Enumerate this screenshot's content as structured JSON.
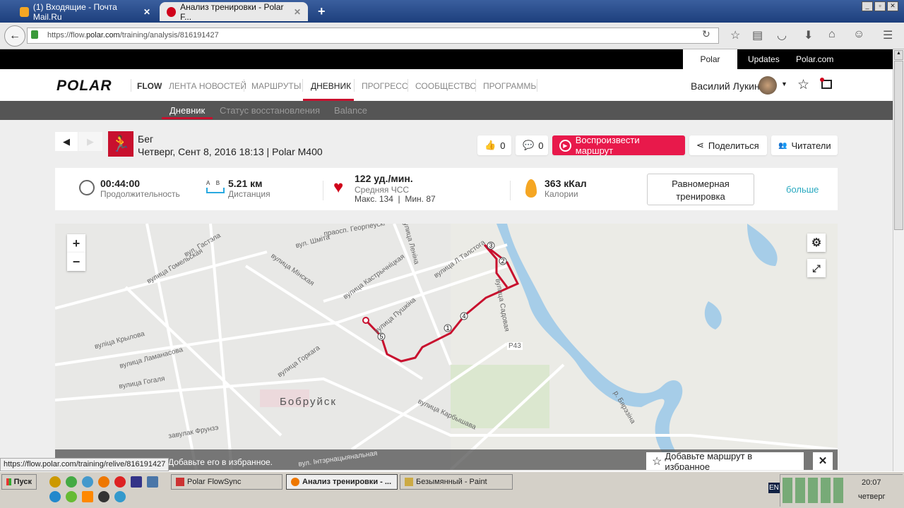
{
  "browser": {
    "tabs": [
      {
        "label": "(1) Входящие - Почта Mail.Ru"
      },
      {
        "label": "Анализ тренировки - Polar F..."
      }
    ],
    "url_prefix": "https://flow.",
    "url_domain": "polar.com",
    "url_path": "/training/analysis/816191427"
  },
  "topbar": {
    "links": [
      "Polar Flow",
      "Updates",
      "Polar.com"
    ]
  },
  "header": {
    "logo": "POLAR",
    "product": "FLOW",
    "nav": [
      "ЛЕНТА НОВОСТЕЙ",
      "МАРШРУТЫ",
      "ДНЕВНИК",
      "ПРОГРЕСС",
      "СООБЩЕСТВО",
      "ПРОГРАММЫ"
    ],
    "user": "Василий Лукин"
  },
  "subnav": [
    "Дневник",
    "Статус восстановления",
    "Balance"
  ],
  "training": {
    "sport": "Бег",
    "date": "Четверг, Сент 8, 2016 18:13 | Polar M400",
    "likes": "0",
    "comments": "0",
    "play": "Воспроизвести маршрут",
    "share": "Поделиться",
    "followers": "Читатели"
  },
  "stats": {
    "duration": "00:44:00",
    "duration_label": "Продолжительность",
    "distance": "5.21 км",
    "distance_label": "Дистанция",
    "ab": "A    B",
    "hr": "122 уд./мин.",
    "hr_label": "Средняя ЧСС",
    "hr_minmax": "Макс. 134  |  Мин. 87",
    "calories": "363 кКал",
    "calories_label": "Калории",
    "type": "Равномерная тренировка",
    "more": "больше"
  },
  "map": {
    "city": "Бобруйск",
    "streets": [
      "вулiца Крылова",
      "вулица Гогаля",
      "вулица Мiнская",
      "вулица Ленiна",
      "вул. Шмiта",
      "вулица Пушкiна",
      "вулица Садовая",
      "завулак Фрунзэ",
      "вулица Ламанасова",
      "вулица Гомельская",
      "вул. Гастэла",
      "праосп. Георгiеўскi",
      "вулица Карбышава",
      "вулица Кастрычнiцкая",
      "вулица Л.Талстога",
      "р. Бярэзiна",
      "вулица Горкага",
      "Р43",
      "вул. Iнтэрнацыянальная"
    ],
    "markers": [
      "1",
      "2",
      "3",
      "4",
      "5"
    ],
    "banner": "Добавьте его в избранное.",
    "fav": "Добавьте маршрут в избранное"
  },
  "statusbar": "https://flow.polar.com/training/relive/816191427",
  "taskbar": {
    "start": "Пуск",
    "tasks": [
      "Polar FlowSync",
      "Анализ тренировки - ...",
      "Безымянный - Paint"
    ],
    "lang": "EN",
    "time": "20:07",
    "day": "четверг"
  }
}
